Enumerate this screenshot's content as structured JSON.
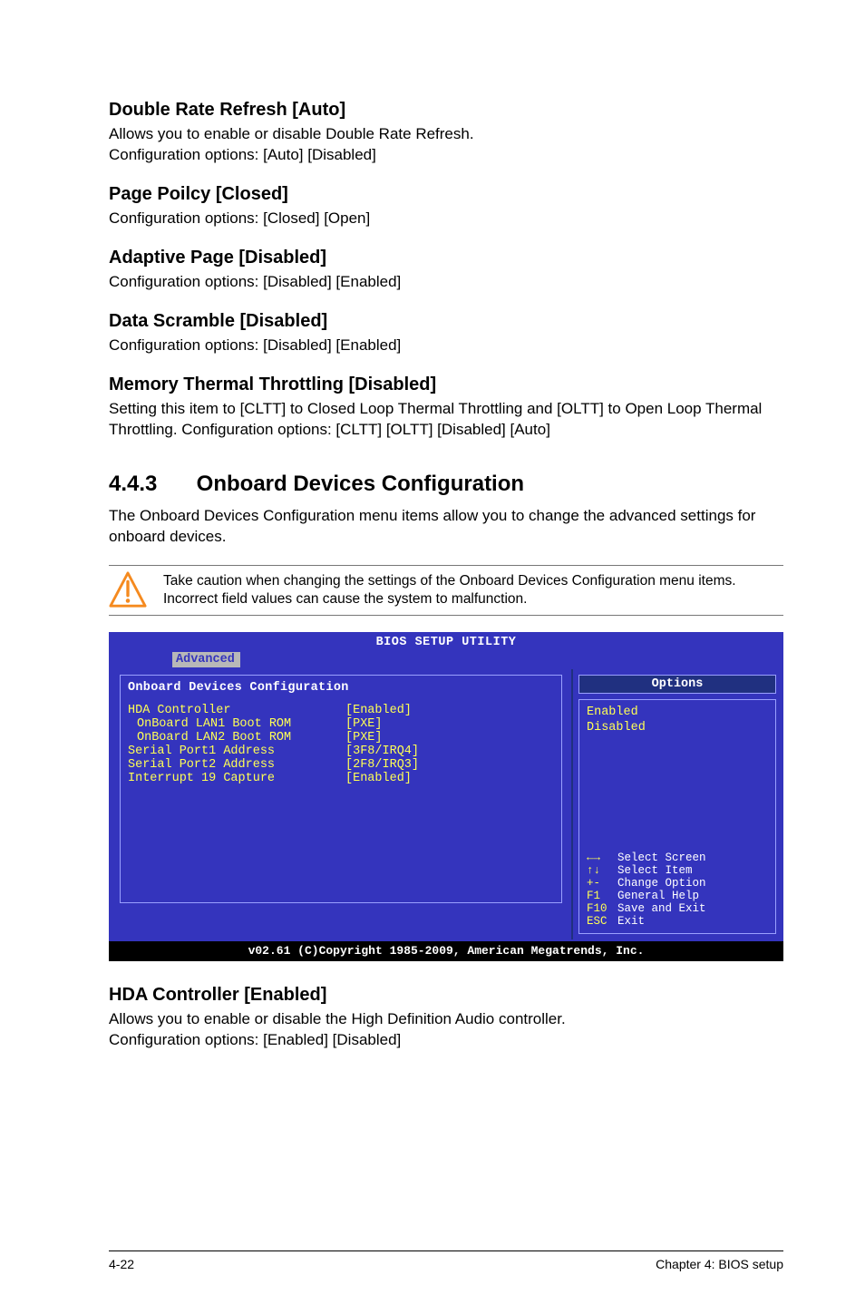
{
  "sections": {
    "drr": {
      "heading": "Double Rate Refresh [Auto]",
      "p1": "Allows you to enable or disable Double Rate Refresh.",
      "p2": "Configuration options: [Auto] [Disabled]"
    },
    "pp": {
      "heading": "Page Poilcy [Closed]",
      "p1": "Configuration options: [Closed] [Open]"
    },
    "ap": {
      "heading": "Adaptive Page [Disabled]",
      "p1": "Configuration options: [Disabled] [Enabled]"
    },
    "ds": {
      "heading": "Data Scramble [Disabled]",
      "p1": "Configuration options: [Disabled] [Enabled]"
    },
    "mtt": {
      "heading": "Memory Thermal Throttling [Disabled]",
      "p1": "Setting this item to [CLTT] to Closed Loop Thermal Throttling and [OLTT] to Open Loop Thermal Throttling. Configuration options: [CLTT] [OLTT] [Disabled] [Auto]"
    },
    "odc_num": "4.4.3",
    "odc_title": "Onboard Devices Configuration",
    "odc_intro": "The Onboard Devices Configuration menu items allow you to change the advanced settings for onboard devices.",
    "caution": "Take caution when changing the settings of the Onboard Devices Configuration menu items. Incorrect field values can cause the system to malfunction.",
    "hda": {
      "heading": "HDA Controller [Enabled]",
      "p1": "Allows you to enable or disable the High Definition Audio controller.",
      "p2": "Configuration options: [Enabled] [Disabled]"
    }
  },
  "bios": {
    "title": "BIOS SETUP UTILITY",
    "tab": "Advanced",
    "left_title": "Onboard Devices Configuration",
    "rows": [
      {
        "label": "HDA Controller",
        "value": "[Enabled]",
        "hl": true,
        "indent": false
      },
      {
        "label": "OnBoard LAN1 Boot ROM",
        "value": "[PXE]",
        "hl": true,
        "indent": true
      },
      {
        "label": "OnBoard LAN2 Boot ROM",
        "value": "[PXE]",
        "hl": true,
        "indent": true
      },
      {
        "label": "Serial Port1 Address",
        "value": "[3F8/IRQ4]",
        "hl": true,
        "indent": false
      },
      {
        "label": "Serial Port2 Address",
        "value": "[2F8/IRQ3]",
        "hl": true,
        "indent": false
      },
      {
        "label": "Interrupt 19 Capture",
        "value": "[Enabled]",
        "hl": true,
        "indent": false
      }
    ],
    "options_header": "Options",
    "options": [
      "Enabled",
      "Disabled"
    ],
    "nav": [
      {
        "key": "←→",
        "text": "Select Screen"
      },
      {
        "key": "↑↓",
        "text": "Select Item"
      },
      {
        "key": "+-",
        "text": "Change Option"
      },
      {
        "key": "F1",
        "text": "General Help"
      },
      {
        "key": "F10",
        "text": "Save and Exit"
      },
      {
        "key": "ESC",
        "text": "Exit"
      }
    ],
    "footer": "v02.61 (C)Copyright 1985-2009, American Megatrends, Inc."
  },
  "footer": {
    "left": "4-22",
    "right": "Chapter 4: BIOS setup"
  }
}
